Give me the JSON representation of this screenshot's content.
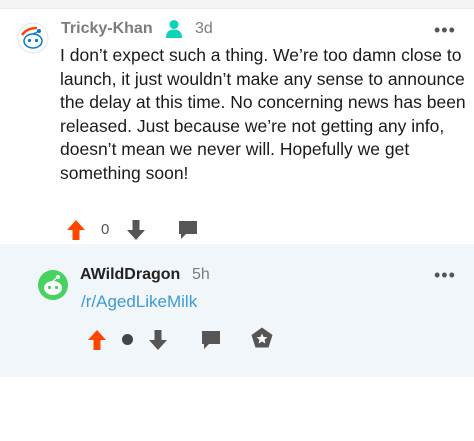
{
  "comment": {
    "username": "Tricky-Khan",
    "time": "3d",
    "body": "I don’t expect such a thing. We’re too damn close to launch, it just wouldn’t make any sense to announce the delay at this time. No concerning news has been released. Just because we’re not getting any info, doesn’t mean we never will. Hopefully we get something soon!",
    "vote_count": "0",
    "more_label": "•••",
    "colors": {
      "upvote": "#ff4500",
      "icon": "#555555",
      "badge": "#0dd3bb"
    }
  },
  "reply": {
    "username": "AWildDragon",
    "time": "5h",
    "link_text": "/r/AgedLikeMilk",
    "more_label": "•••",
    "colors": {
      "background": "#f1f6fa",
      "link": "#3d9ad6",
      "avatar": "#46d160"
    }
  }
}
